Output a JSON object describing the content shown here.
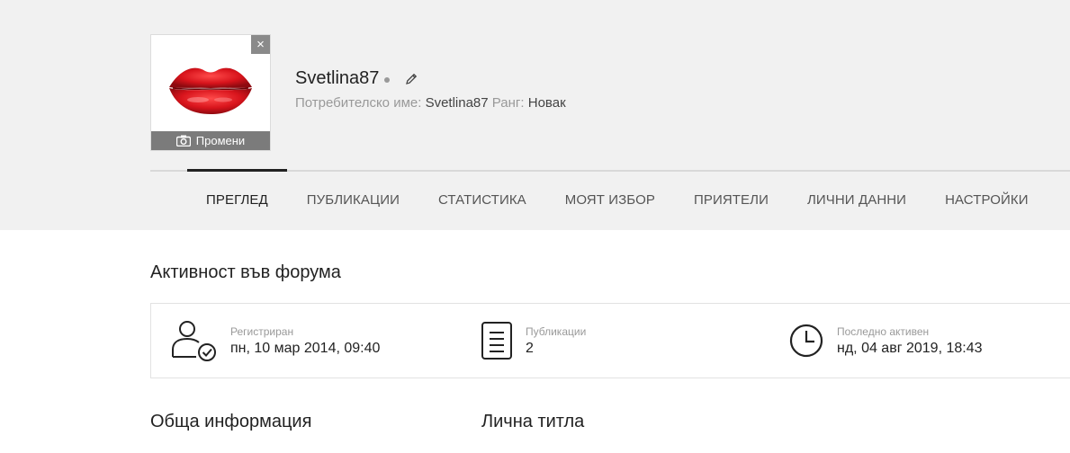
{
  "profile": {
    "avatar_change_label": "Промени",
    "close_symbol": "×",
    "username": "Svetlina87",
    "username_label": "Потребителско име:",
    "username_value": "Svetlina87",
    "rank_label": "Ранг:",
    "rank_value": "Новак"
  },
  "tabs": [
    {
      "label": "ПРЕГЛЕД",
      "active": true
    },
    {
      "label": "ПУБЛИКАЦИИ"
    },
    {
      "label": "СТАТИСТИКА"
    },
    {
      "label": "МОЯТ ИЗБОР"
    },
    {
      "label": "ПРИЯТЕЛИ"
    },
    {
      "label": "ЛИЧНИ ДАННИ"
    },
    {
      "label": "НАСТРОЙКИ"
    }
  ],
  "activity": {
    "title": "Активност във форума",
    "registered": {
      "label": "Регистриран",
      "value": "пн, 10 мар 2014, 09:40",
      "icon": "user-check-icon"
    },
    "posts": {
      "label": "Публикации",
      "value": "2",
      "icon": "document-icon"
    },
    "last_active": {
      "label": "Последно активен",
      "value": "нд, 04 авг 2019, 18:43",
      "icon": "clock-icon"
    }
  },
  "general_info": {
    "title": "Обща информация"
  },
  "personal_title": {
    "title": "Лична титла"
  },
  "colors": {
    "header_bg": "#f1f1f1",
    "lips": "#d8141c",
    "avatar_bar": "#7b7b7b"
  }
}
